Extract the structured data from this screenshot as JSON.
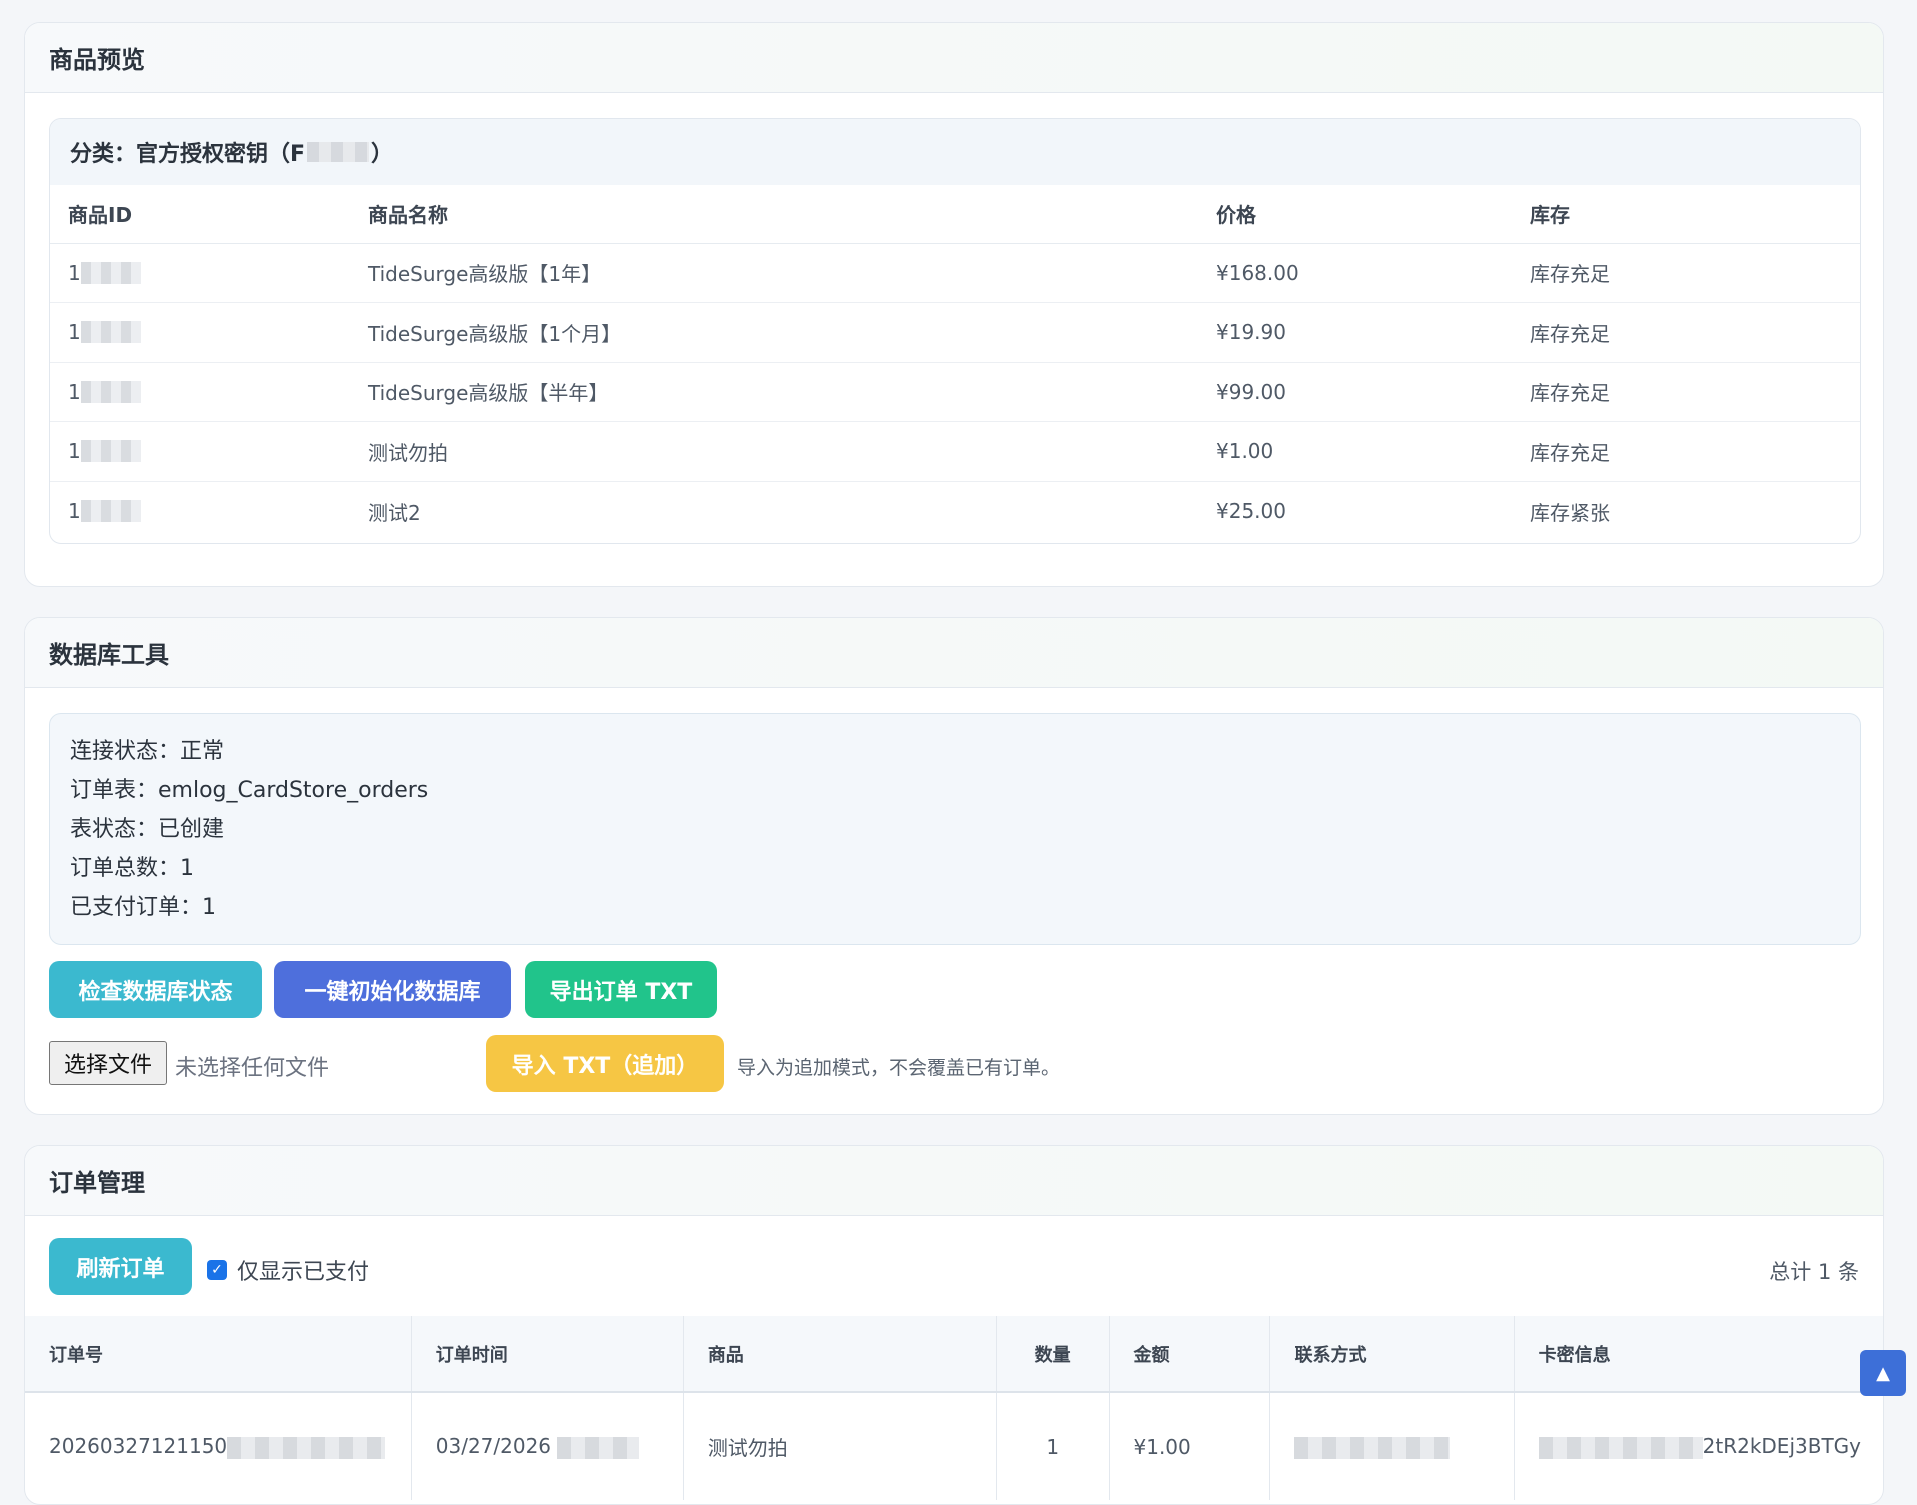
{
  "preview": {
    "title": "商品预览",
    "category_title_prefix": "分类：官方授权密钥（F",
    "category_title_suffix": "）",
    "columns": [
      "商品ID",
      "商品名称",
      "价格",
      "库存"
    ],
    "rows": [
      {
        "id": "1",
        "name": "TideSurge高级版【1年】",
        "price": "¥168.00",
        "stock": "库存充足"
      },
      {
        "id": "1",
        "name": "TideSurge高级版【1个月】",
        "price": "¥19.90",
        "stock": "库存充足"
      },
      {
        "id": "1",
        "name": "TideSurge高级版【半年】",
        "price": "¥99.00",
        "stock": "库存充足"
      },
      {
        "id": "1",
        "name": "测试勿拍",
        "price": "¥1.00",
        "stock": "库存充足"
      },
      {
        "id": "1",
        "name": "测试2",
        "price": "¥25.00",
        "stock": "库存紧张"
      }
    ]
  },
  "db": {
    "title": "数据库工具",
    "info": [
      "连接状态：正常",
      "订单表：emlog_CardStore_orders",
      "表状态：已创建",
      "订单总数：1",
      "已支付订单：1"
    ],
    "buttons": {
      "check": "检查数据库状态",
      "init": "一键初始化数据库",
      "export": "导出订单 TXT",
      "import": "导入 TXT（追加）"
    },
    "file_button": "选择文件",
    "file_none": "未选择任何文件",
    "import_note": "导入为追加模式，不会覆盖已有订单。",
    "colors": {
      "cyan": "#3bb9cf",
      "blue": "#4e6fdc",
      "green": "#21c48b",
      "yellow": "#f6c644"
    }
  },
  "orders": {
    "title": "订单管理",
    "refresh_button": "刷新订单",
    "only_paid_label": "仅显示已支付",
    "only_paid_checked": true,
    "total": "总计 1 条",
    "columns": [
      "订单号",
      "订单时间",
      "商品",
      "数量",
      "金额",
      "联系方式",
      "卡密信息"
    ],
    "rows": [
      {
        "order_no": "20260327121150",
        "time": "03/27/2026",
        "product": "测试勿拍",
        "qty": "1",
        "amount": "¥1.00",
        "contact": "",
        "card": "2tR2kDEj3BTGy"
      }
    ]
  },
  "icons": {
    "scroll_top": "arrow-up-icon",
    "checkbox": "check-icon"
  }
}
